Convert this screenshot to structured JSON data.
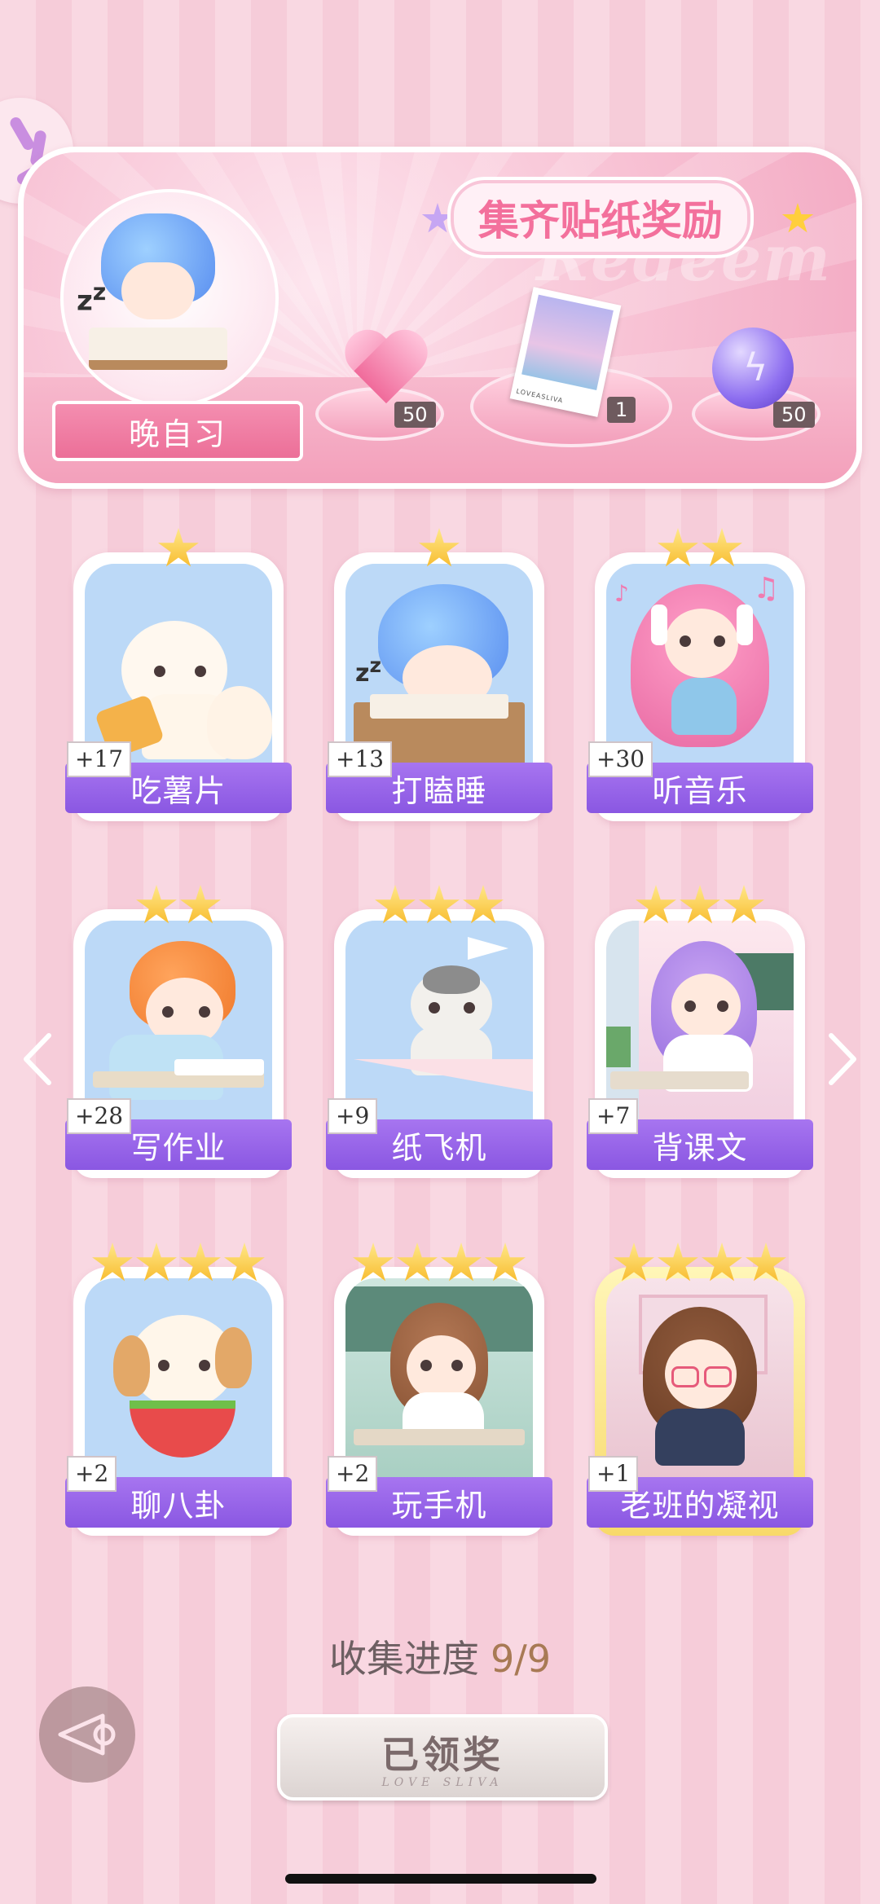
{
  "banner": {
    "title": "集齐贴纸奖励",
    "watermark": "Redeem",
    "set_name": "晚自习",
    "rewards": [
      {
        "icon": "heart-gem-icon",
        "count": "50"
      },
      {
        "icon": "photo-card-icon",
        "count": "1",
        "photo_caption": "LOVEASLIVA"
      },
      {
        "icon": "energy-orb-icon",
        "count": "50"
      }
    ]
  },
  "stickers": [
    {
      "label": "吃薯片",
      "bonus": "+17",
      "stars": 1
    },
    {
      "label": "打瞌睡",
      "bonus": "+13",
      "stars": 1
    },
    {
      "label": "听音乐",
      "bonus": "+30",
      "stars": 2
    },
    {
      "label": "写作业",
      "bonus": "+28",
      "stars": 2
    },
    {
      "label": "纸飞机",
      "bonus": "+9",
      "stars": 3
    },
    {
      "label": "背课文",
      "bonus": "+7",
      "stars": 3
    },
    {
      "label": "聊八卦",
      "bonus": "+2",
      "stars": 4
    },
    {
      "label": "玩手机",
      "bonus": "+2",
      "stars": 4
    },
    {
      "label": "老班的凝视",
      "bonus": "+1",
      "stars": 4
    }
  ],
  "progress": {
    "label": "收集进度",
    "value": "9/9"
  },
  "claim_button": {
    "label": "已领奖",
    "subtext": "LOVE SLIVA"
  },
  "colors": {
    "accent": "#f3709c",
    "label_purple": "#9460e6",
    "star_gold": "#f7b928"
  }
}
